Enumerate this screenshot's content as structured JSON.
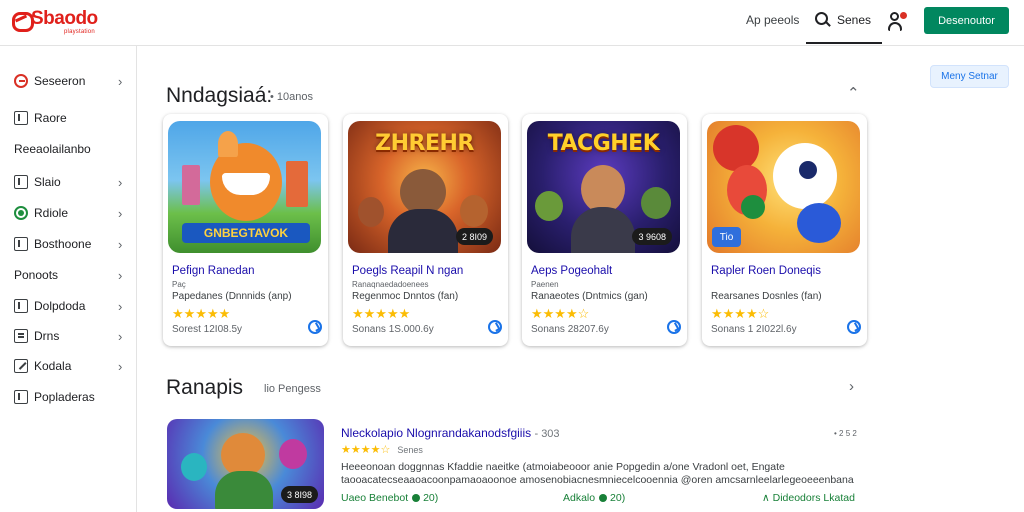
{
  "header": {
    "logo_text": "Sbaodo",
    "logo_sub": "playstation",
    "link": "Ap peeols",
    "search_label": "Senes",
    "cta_label": "Desenoutor"
  },
  "sidebar": {
    "items": [
      {
        "label": "Seseeron",
        "icon": "remove-circle-icon",
        "chevron": true
      },
      {
        "label": "Raore",
        "icon": "bookmark-icon",
        "chevron": false
      },
      {
        "label": "Reeaolailanbo",
        "icon": "",
        "chevron": false
      },
      {
        "label": "Slaio",
        "icon": "bookmark-icon",
        "chevron": true
      },
      {
        "label": "Rdiole",
        "icon": "record-icon",
        "chevron": true
      },
      {
        "label": "Bosthoone",
        "icon": "bookmark-icon",
        "chevron": true
      },
      {
        "label": "Ponoots",
        "icon": "",
        "chevron": true
      },
      {
        "label": "Dolpdoda",
        "icon": "bookmark-icon",
        "chevron": true
      },
      {
        "label": "Drns",
        "icon": "list-icon",
        "chevron": true
      },
      {
        "label": "Kodala",
        "icon": "edit-icon",
        "chevron": true
      },
      {
        "label": "Popladeras",
        "icon": "bookmark-icon",
        "chevron": false
      }
    ]
  },
  "section1": {
    "title": "Nndagsiaá:",
    "subtitle": "• 10anos",
    "action_label": "Meny Setnar"
  },
  "cards": [
    {
      "thumb_title": "",
      "thumb_banner": "GNBEGTAVOK",
      "thumb_badge": "",
      "name": "Pefign Ranedan",
      "line2": "Paç",
      "line3": "Papedanes (Dnnnids (anp)",
      "stars": "★★★★★",
      "rating": "Sorest 12I08.5y"
    },
    {
      "thumb_title": "ZHREHR",
      "thumb_banner": "",
      "thumb_badge": "2 8I09",
      "name": "Poegls Reapil N ngan",
      "line2": "Ranaqnaedadoenees",
      "line3": "Regenmoc Dnntos (fan)",
      "stars": "★★★★★",
      "rating": "Sonans 1S.000.6y"
    },
    {
      "thumb_title": "TACGHEK",
      "thumb_banner": "",
      "thumb_badge": "3 9608",
      "name": "Aeps Pogeohalt",
      "line2": "Paenen",
      "line3": "Ranaeotes (Dntmics (gan)",
      "stars": "★★★★☆",
      "rating": "Sonans 28207.6y"
    },
    {
      "thumb_title": "",
      "thumb_banner": "",
      "thumb_badge_left": "Tio",
      "name": "Rapler Roen Doneqis",
      "line2": "",
      "line3": "Rearsanes Dosnles (fan)",
      "stars": "★★★★☆",
      "rating": "Sonans 1 2I022l.6y"
    }
  ],
  "section2": {
    "title": "Ranapis",
    "subtitle": "lio Pengess"
  },
  "list_item": {
    "thumb_badge": "3 8I98",
    "title": "Nleckolapio Nlognrandakanodsfgiiis",
    "title_suffix": "- 303",
    "stars": "★★★★☆",
    "stars_label": "Senes",
    "right_meta": "• 2 5 2",
    "desc_lines": [
      "Heeeonoan doggnnas  Kfaddie  naeitke (atmoiabeooor anie  Popgedin a/one Vradonl oet, Engate",
      "taooacatecseaaoacoonpamaoaoonoe amosenobiacnesmniecelcooennia @oren amcsarnleelarlegeoeeenbana"
    ],
    "foot": [
      {
        "text": "Uaeo Benebot",
        "extra": "20)"
      },
      {
        "text": "Adkalo",
        "extra": "20)"
      },
      {
        "text": "Dideodors Lkatad",
        "extra": ""
      }
    ]
  },
  "colors": {
    "accent_green": "#01875f",
    "link_blue": "#1a0dab",
    "star": "#fbbc04",
    "brand_red": "#e0201b"
  }
}
